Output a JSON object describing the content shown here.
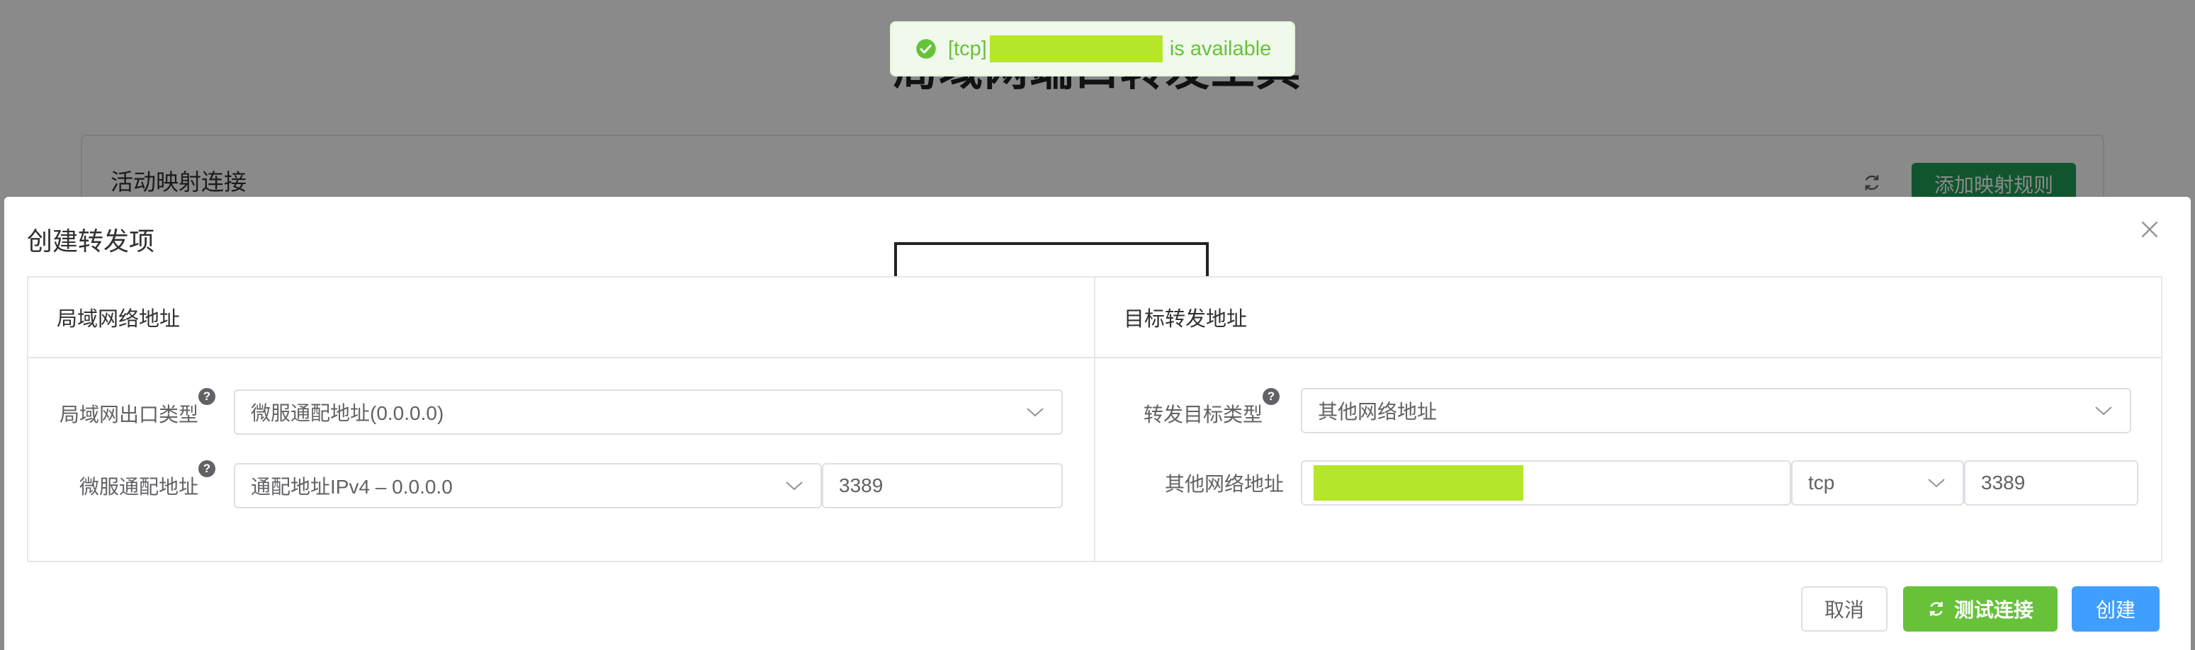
{
  "background": {
    "title": "局域网端口转发工具",
    "card_title": "活动映射连接",
    "add_button_label": "添加映射规则"
  },
  "toast": {
    "prefix": "[tcp]",
    "suffix": "is available",
    "icon": "check-circle-icon",
    "color": "#67c23a"
  },
  "dialog": {
    "title": "创建转发项",
    "left_panel": {
      "title": "局域网络地址",
      "exit_type_label": "局域网出口类型",
      "exit_type_value": "微服通配地址(0.0.0.0)",
      "wildcard_label": "微服通配地址",
      "wildcard_value": "通配地址IPv4 – 0.0.0.0",
      "port_value": "3389"
    },
    "right_panel": {
      "title": "目标转发地址",
      "target_type_label": "转发目标类型",
      "target_type_value": "其他网络地址",
      "other_addr_label": "其他网络地址",
      "protocol_value": "tcp",
      "port_value": "3389"
    },
    "buttons": {
      "cancel": "取消",
      "test": "测试连接",
      "create": "创建"
    }
  },
  "colors": {
    "success": "#67c23a",
    "primary": "#409eff",
    "redaction": "#b5e629",
    "brand_green": "#1f9d55"
  }
}
